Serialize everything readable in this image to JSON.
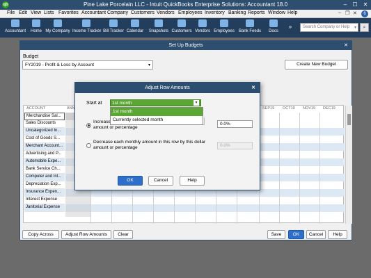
{
  "app": {
    "title": "Pine Lake Porcelain LLC  -  Intuit QuickBooks Enterprise Solutions: Accountant 18.0",
    "icon": "qb",
    "controls": [
      "–",
      "☐",
      "✕"
    ]
  },
  "menubar": {
    "items": [
      "File",
      "Edit",
      "View",
      "Lists",
      "Favorites",
      "Accountant",
      "Company",
      "Customers",
      "Vendors",
      "Employees",
      "Inventory",
      "Banking",
      "Reports",
      "Window",
      "Help"
    ],
    "badge": "6",
    "controls": [
      "–",
      "❐",
      "✕"
    ]
  },
  "toolbar": {
    "items": [
      "Accountant",
      "Home",
      "My Company",
      "Income Tracker",
      "Bill Tracker",
      "Calendar",
      "Snapshots",
      "Customers",
      "Vendors",
      "Employees",
      "Bank Feeds",
      "Docs"
    ],
    "more": "»",
    "search_placeholder": "Search Company or Help",
    "search_arrow": "▾",
    "search_icon": "⌕"
  },
  "budget_dialog": {
    "title": "Set Up Budgets",
    "close": "✕",
    "budget_label": "Budget",
    "budget_value": "FY2019 - Profit & Loss by Account",
    "select_arrow": "▾",
    "create_button": "Create New Budget",
    "columns": [
      "ACCOUNT",
      "ANN",
      "SEP19",
      "OCT19",
      "NOV19",
      "DEC19"
    ],
    "accounts": [
      "Merchandise Sal...",
      "Sales Discounts",
      "Uncategorized In...",
      "Cost of Goods S...",
      "Merchant Account...",
      "Advertising and P...",
      "Automobile Expe...",
      "Bank Service Ch...",
      "Computer and Int...",
      "Depreciation Exp...",
      "Insurance Expen...",
      "Interest Expense",
      "Janitorial Expense"
    ],
    "buttons": {
      "copy_across": "Copy Across",
      "adjust_row_amounts": "Adjust Row Amounts",
      "clear": "Clear",
      "save": "Save",
      "ok": "OK",
      "cancel": "Cancel",
      "help": "Help"
    }
  },
  "adjust_dialog": {
    "title": "Adjust Row Amounts",
    "close": "✕",
    "start_at_label": "Start at",
    "start_at_value": "1st month",
    "select_arrow": "▾",
    "options": [
      "1st month",
      "Currently selected month"
    ],
    "increase_text_line1": "Increase",
    "increase_text_line2": "amount or percentage",
    "increase_value": "0.0%",
    "decrease_text_line1": "Decrease each monthly amount in this row by this dollar",
    "decrease_text_line2": "amount or percentage",
    "decrease_value": "0.0%",
    "buttons": {
      "ok": "OK",
      "cancel": "Cancel",
      "help": "Help"
    }
  },
  "colors": {
    "title_bar": "#2d4e6e",
    "icon_bar": "#233d5c",
    "accent_green": "#5aa833",
    "primary_button": "#2d6fca",
    "row_band": "#dde8f5"
  }
}
